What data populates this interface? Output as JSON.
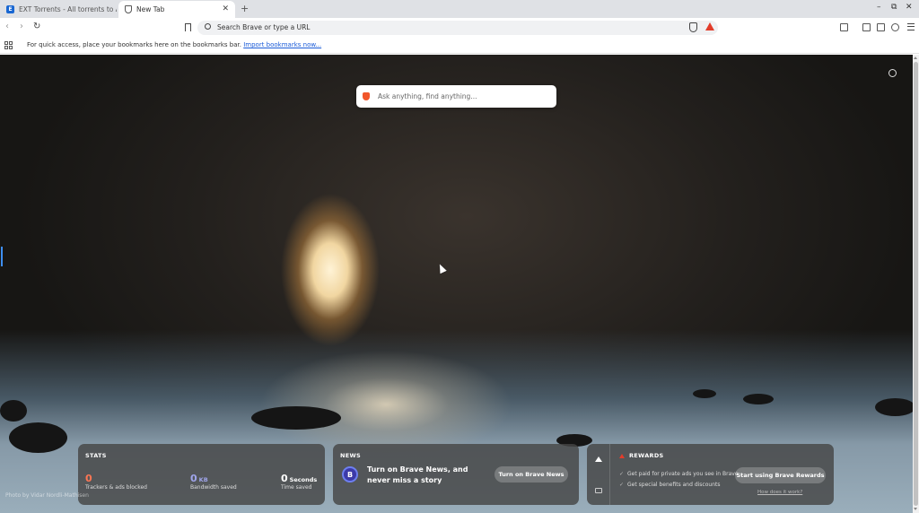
{
  "tabs": [
    {
      "title": "EXT Torrents - All torrents to All",
      "icon": "ext-favicon-icon",
      "active": false
    },
    {
      "title": "New Tab",
      "icon": "brave-shield-favicon-icon",
      "active": true
    }
  ],
  "tabstrip": {
    "new_tab_glyph": "+",
    "close_glyph": "✕"
  },
  "window_controls": {
    "minimize": "–",
    "restore": "⧉",
    "close": "✕"
  },
  "toolbar": {
    "back_glyph": "‹",
    "forward_glyph": "›",
    "reload_glyph": "↻",
    "omnibox_placeholder": "Search Brave or type a URL"
  },
  "bookmarks_bar": {
    "message": "For quick access, place your bookmarks here on the bookmarks bar.",
    "import_link": "Import bookmarks now..."
  },
  "ntp": {
    "search_placeholder": "Ask anything, find anything...",
    "photo_credit": "Photo by Vidar Nordli-Mathisen"
  },
  "stats": {
    "title": "STATS",
    "trackers": {
      "value": "0",
      "label": "Trackers & ads blocked"
    },
    "bandwidth": {
      "value": "0",
      "unit": "KB",
      "label": "Bandwidth saved"
    },
    "time": {
      "value": "0",
      "unit": "Seconds",
      "label": "Time saved"
    }
  },
  "news": {
    "title": "NEWS",
    "logo_letter": "B",
    "text": "Turn on Brave News, and never miss a story",
    "button": "Turn on Brave News"
  },
  "rewards": {
    "title": "REWARDS",
    "items": [
      "Get paid for private ads you see in Brave",
      "Get special benefits and discounts"
    ],
    "check_glyph": "✓",
    "button": "Start using Brave Rewards",
    "link": "How does it work?"
  },
  "colors": {
    "accent_blue": "#3e8ef0",
    "trackers_orange": "#ff7654",
    "bandwidth_purple": "#a0a5eb",
    "brave_orange": "#f1562b",
    "bat_red": "#e23c2a"
  }
}
